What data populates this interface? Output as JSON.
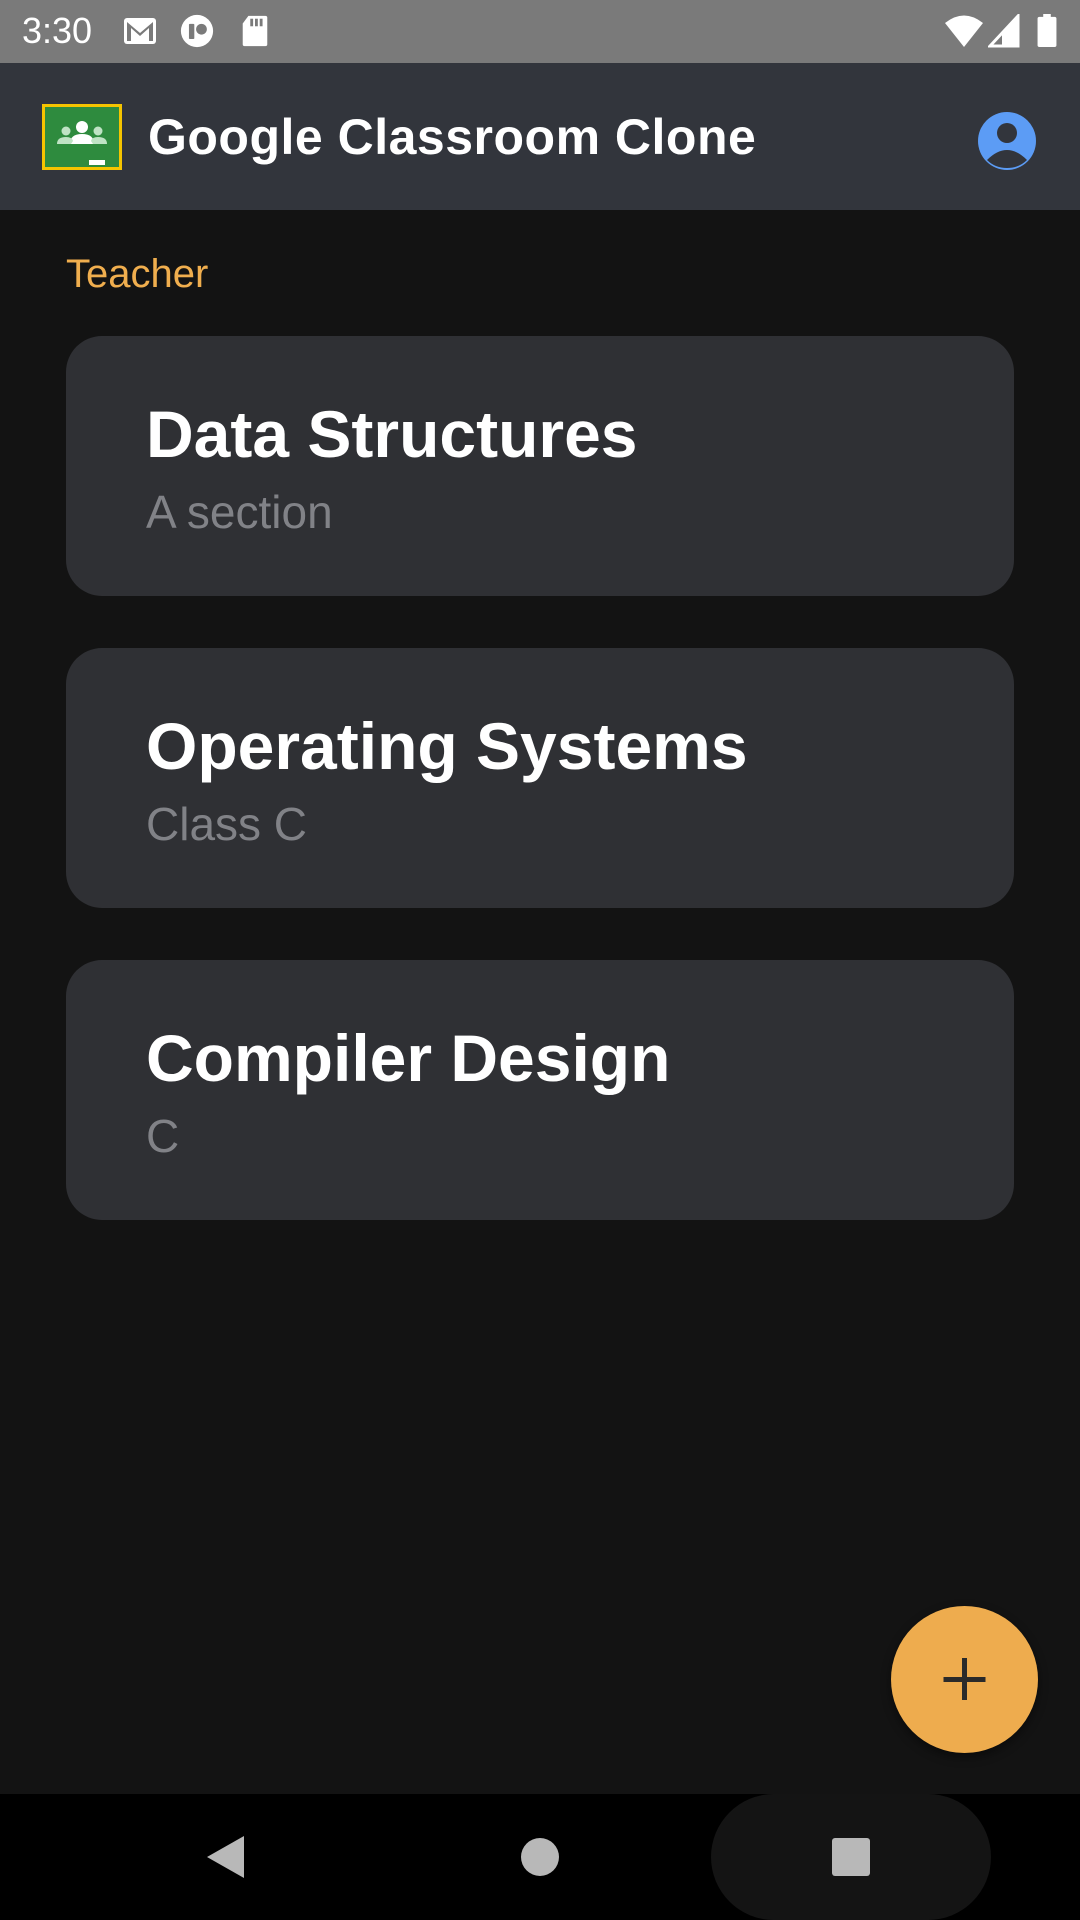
{
  "status_bar": {
    "time": "3:30",
    "left_icons": [
      "gmail-icon",
      "app-notification-icon",
      "sd-card-icon"
    ],
    "right_icons": [
      "wifi-icon",
      "cell-signal-icon",
      "battery-icon"
    ]
  },
  "app_bar": {
    "title": "Google Classroom Clone",
    "logo_icon": "google-classroom-logo",
    "account_icon": "account-circle-icon",
    "logo_colors": {
      "board": "#2e8b3e",
      "border": "#f5c400"
    },
    "account_color": "#5c9cf5"
  },
  "section": {
    "label": "Teacher",
    "color": "#f0ae4e"
  },
  "classes": [
    {
      "title": "Data Structures",
      "subtitle": "A section"
    },
    {
      "title": "Operating Systems",
      "subtitle": "Class C"
    },
    {
      "title": "Compiler Design",
      "subtitle": "C"
    }
  ],
  "fab": {
    "icon": "plus-icon",
    "color": "#eeac4e"
  },
  "nav_bar": {
    "buttons": [
      "back-icon",
      "home-icon",
      "recents-icon"
    ]
  }
}
